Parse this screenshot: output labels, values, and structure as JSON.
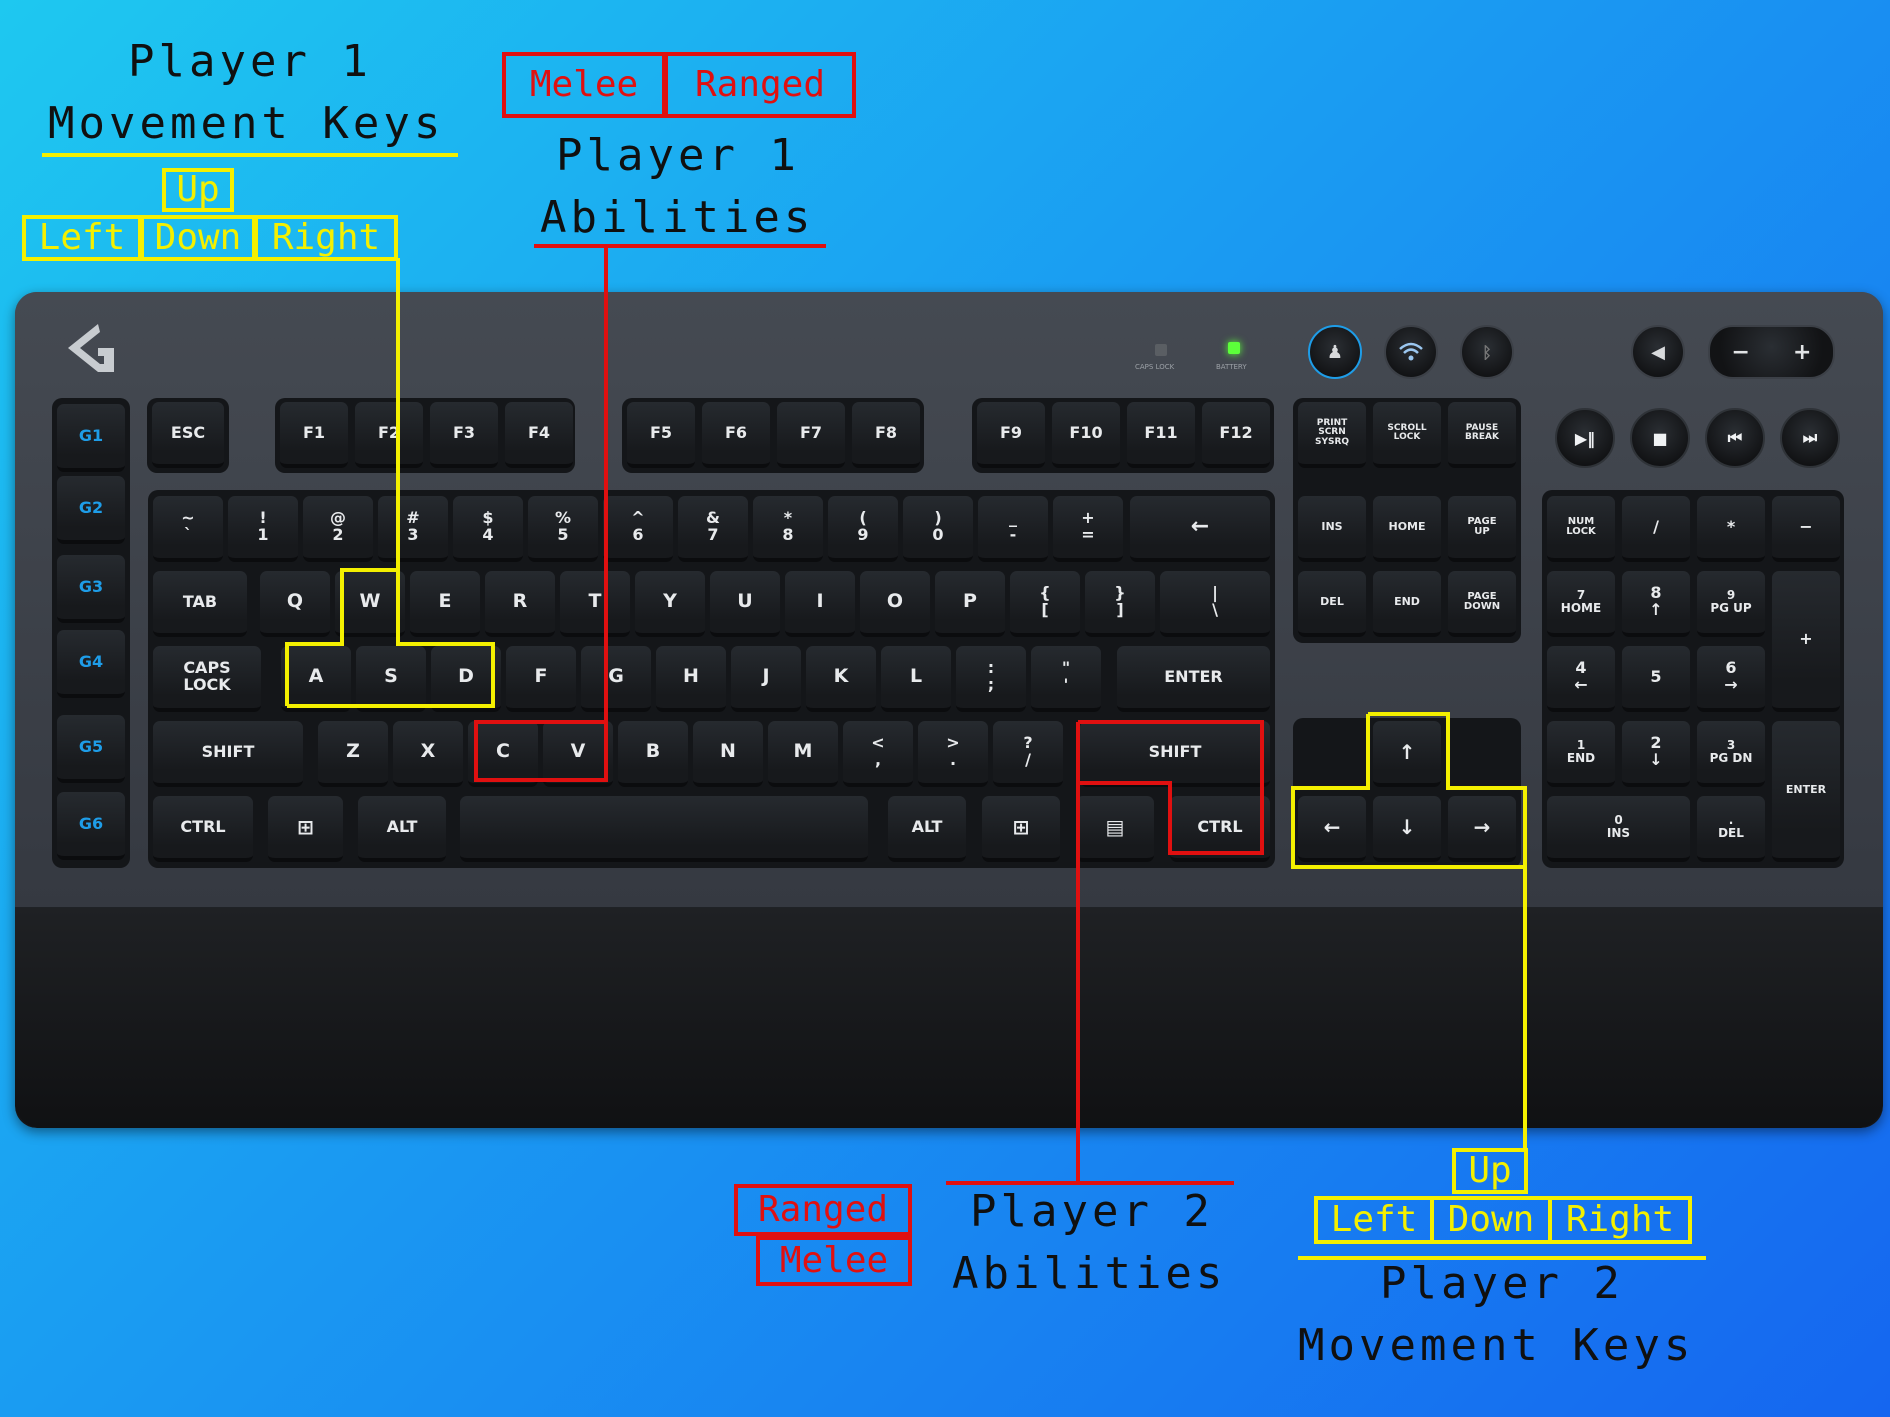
{
  "colors": {
    "yellow": "#f4f000",
    "red": "#e01010",
    "led_green": "#5cff3a",
    "g_key_blue": "#1e9de8"
  },
  "player1": {
    "movement_title_line1": "Player 1",
    "movement_title_line2": "Movement Keys",
    "up": "Up",
    "left": "Left",
    "down": "Down",
    "right": "Right",
    "melee": "Melee",
    "ranged": "Ranged",
    "abilities_line1": "Player 1",
    "abilities_line2": "Abilities"
  },
  "player2": {
    "abilities_line1": "Player 2",
    "abilities_line2": "Abilities",
    "ranged": "Ranged",
    "melee": "Melee",
    "up": "Up",
    "left": "Left",
    "down": "Down",
    "right": "Right",
    "movement_title_line1": "Player 2",
    "movement_title_line2": "Movement Keys"
  },
  "indicators": {
    "caps_lock": "CAPS LOCK",
    "battery": "BATTERY"
  },
  "icons": {
    "logo": "logitech-g-logo-icon",
    "game_mode": "joystick-icon",
    "wireless": "wifi-icon",
    "bluetooth": "bluetooth-icon",
    "mute": "speaker-icon",
    "volume": "volume-rocker-icon"
  },
  "volume": {
    "minus": "−",
    "plus": "+"
  },
  "media": {
    "play_pause": "▶‖",
    "stop": "■",
    "prev": "⏮",
    "next": "⏭"
  },
  "keys": {
    "g1": "G1",
    "g2": "G2",
    "g3": "G3",
    "g4": "G4",
    "g5": "G5",
    "g6": "G6",
    "esc": "ESC",
    "f1": "F1",
    "f2": "F2",
    "f3": "F3",
    "f4": "F4",
    "f5": "F5",
    "f6": "F6",
    "f7": "F7",
    "f8": "F8",
    "f9": "F9",
    "f10": "F10",
    "f11": "F11",
    "f12": "F12",
    "prtsc": "PRINT\nSCRN\nSYSRQ",
    "scrlk": "SCROLL\nLOCK",
    "pause": "PAUSE\nBREAK",
    "tilde": "~\n`",
    "k1": "!\n1",
    "k2": "@\n2",
    "k3": "#\n3",
    "k4": "$\n4",
    "k5": "%\n5",
    "k6": "^\n6",
    "k7": "&\n7",
    "k8": "*\n8",
    "k9": "(\n9",
    "k0": ")\n0",
    "minus": "_\n-",
    "equals": "+\n=",
    "backspace": "←",
    "ins": "INS",
    "home": "HOME",
    "pgup": "PAGE\nUP",
    "numlock": "NUM\nLOCK",
    "npdiv": "/",
    "npmul": "*",
    "npsub": "−",
    "tab": "TAB",
    "q": "Q",
    "w": "W",
    "e": "E",
    "r": "R",
    "t": "T",
    "y": "Y",
    "u": "U",
    "i": "I",
    "o": "O",
    "p": "P",
    "lbr": "{\n[",
    "rbr": "}\n]",
    "bslash": "|\n\\",
    "del": "DEL",
    "end": "END",
    "pgdn": "PAGE\nDOWN",
    "np7": "7\nHOME",
    "np8": "8\n↑",
    "np9": "9\nPG UP",
    "npadd": "+",
    "caps": "CAPS\nLOCK",
    "a": "A",
    "s": "S",
    "d": "D",
    "f": "F",
    "g": "G",
    "h": "H",
    "j": "J",
    "k": "K",
    "l": "L",
    "semi": ":\n;",
    "quote": "\"\n'",
    "enter": "ENTER",
    "np4": "4\n←",
    "np5": "5",
    "np6": "6\n→",
    "lshift": "SHIFT",
    "z": "Z",
    "x": "X",
    "c": "C",
    "v": "V",
    "b": "B",
    "n": "N",
    "m": "M",
    "comma": "<\n,",
    "period": ">\n.",
    "slash": "?\n/",
    "rshift": "SHIFT",
    "up": "↑",
    "np1": "1\nEND",
    "np2": "2\n↓",
    "np3": "3\nPG DN",
    "npenter": "ENTER",
    "lctrl": "CTRL",
    "lwin": "⊞",
    "lalt": "ALT",
    "space": "",
    "ralt": "ALT",
    "rwin": "⊞",
    "menu": "▤",
    "rctrl": "CTRL",
    "left": "←",
    "down": "↓",
    "right": "→",
    "np0": "0\nINS",
    "npdot": ".\nDEL"
  }
}
